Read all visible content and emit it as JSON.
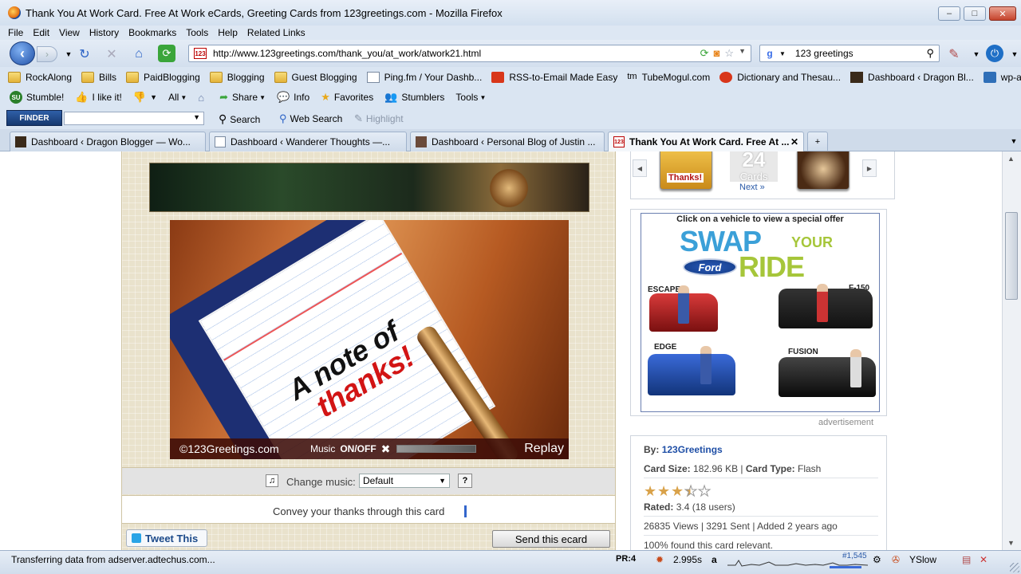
{
  "window": {
    "title": "Thank You At Work Card. Free At Work eCards, Greeting Cards from 123greetings.com - Mozilla Firefox",
    "buttons": [
      "–",
      "□",
      "✕"
    ]
  },
  "menu": [
    "File",
    "Edit",
    "View",
    "History",
    "Bookmarks",
    "Tools",
    "Help",
    "Related Links"
  ],
  "nav": {
    "url": "http://www.123greetings.com/thank_you/at_work/atwork21.html",
    "favicon_text": "123",
    "search_value": "123 greetings",
    "search_engine": "g"
  },
  "bookmarks": [
    {
      "label": "RockAlong",
      "icon": "folder"
    },
    {
      "label": "Bills",
      "icon": "folder"
    },
    {
      "label": "PaidBlogging",
      "icon": "folder"
    },
    {
      "label": "Blogging",
      "icon": "folder"
    },
    {
      "label": "Guest Blogging",
      "icon": "folder"
    },
    {
      "label": "Ping.fm / Your Dashb...",
      "icon": "page"
    },
    {
      "label": "RSS-to-Email Made Easy",
      "icon": "red"
    },
    {
      "label": "TubeMogul.com",
      "icon": "tm"
    },
    {
      "label": "Dictionary and Thesau...",
      "icon": "red"
    },
    {
      "label": "Dashboard ‹ Dragon Bl...",
      "icon": "dark"
    },
    {
      "label": "wp-admin",
      "icon": "blue"
    }
  ],
  "stumble": {
    "logo": "SU",
    "items": [
      "Stumble!",
      "I like it!",
      "All",
      "Share",
      "Info",
      "Favorites",
      "Stumblers",
      "Tools"
    ]
  },
  "finder": {
    "logo": "FINDER",
    "search": "Search",
    "websearch": "Web Search",
    "highlight": "Highlight"
  },
  "tabs": [
    {
      "label": "Dashboard ‹ Dragon Blogger — Wo...",
      "active": false
    },
    {
      "label": "Dashboard ‹ Wanderer Thoughts —...",
      "active": false
    },
    {
      "label": "Dashboard ‹ Personal Blog of Justin ...",
      "active": false
    },
    {
      "label": "Thank You At Work Card. Free At ...",
      "active": true
    }
  ],
  "card": {
    "line1": "A note of",
    "line2": "thanks!",
    "copyright": "©123Greetings.com",
    "music_label": "Music",
    "onoff": "ON/OFF",
    "replay": "Replay",
    "change_music_label": "Change music:",
    "music_select": "Default",
    "help": "?",
    "message": "Convey your thanks through this card",
    "tweet": "Tweet This",
    "send": "Send this ecard"
  },
  "carousel": {
    "thumb_label": "Thanks!",
    "count": "24",
    "count_label": "Cards",
    "next": "Next »"
  },
  "ad": {
    "header": "Click on a vehicle to view a special offer",
    "swap": "SWAP",
    "your": "YOUR",
    "ride": "RIDE",
    "brand": "Ford",
    "vehicles": [
      "ESCAPE",
      "F-150",
      "EDGE",
      "FUSION"
    ],
    "label": "advertisement"
  },
  "info": {
    "by_label": "By:",
    "by_value": "123Greetings",
    "size_label": "Card Size:",
    "size_value": "182.96 KB",
    "type_label": "Card Type:",
    "type_value": "Flash",
    "rating_stars": 3.4,
    "rated_label": "Rated:",
    "rated_value": "3.4 (18 users)",
    "stats": "26835 Views | 3291 Sent | Added 2 years ago",
    "relevance": "100% found this card relevant."
  },
  "status": {
    "message": "Transferring data from adserver.adtechus.com...",
    "pr": "PR:4",
    "time": "2.995s",
    "rank": "#1,545",
    "yslow": "YSlow"
  }
}
